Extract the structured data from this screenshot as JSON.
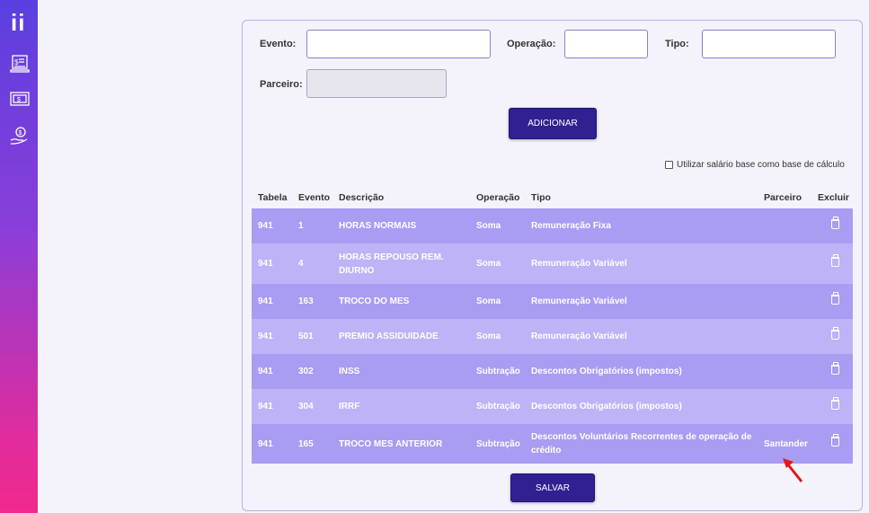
{
  "sidebar": {
    "logo": "ii",
    "items": [
      {
        "icon": "payroll-screen-icon"
      },
      {
        "icon": "banknote-icon"
      },
      {
        "icon": "hand-money-icon"
      }
    ]
  },
  "form": {
    "evento_label": "Evento:",
    "evento_value": "",
    "operacao_label": "Operação:",
    "operacao_value": "",
    "tipo_label": "Tipo:",
    "tipo_value": "",
    "parceiro_label": "Parceiro:",
    "parceiro_value": "",
    "add_button": "ADICIONAR",
    "checkbox_label": "Utilizar salário base como base de cálculo",
    "checkbox_checked": false
  },
  "table": {
    "headers": [
      "Tabela",
      "Evento",
      "Descrição",
      "Operação",
      "Tipo",
      "Parceiro",
      "Excluir"
    ],
    "rows": [
      {
        "tabela": "941",
        "evento": "1",
        "descricao": "HORAS NORMAIS",
        "operacao": "Soma",
        "tipo": "Remuneração Fixa",
        "parceiro": ""
      },
      {
        "tabela": "941",
        "evento": "4",
        "descricao": "HORAS REPOUSO REM. DIURNO",
        "operacao": "Soma",
        "tipo": "Remuneração Variável",
        "parceiro": ""
      },
      {
        "tabela": "941",
        "evento": "163",
        "descricao": "TROCO DO MES",
        "operacao": "Soma",
        "tipo": "Remuneração Variável",
        "parceiro": ""
      },
      {
        "tabela": "941",
        "evento": "501",
        "descricao": "PREMIO ASSIDUIDADE",
        "operacao": "Soma",
        "tipo": "Remuneração Variável",
        "parceiro": ""
      },
      {
        "tabela": "941",
        "evento": "302",
        "descricao": "INSS",
        "operacao": "Subtração",
        "tipo": "Descontos Obrigatórios (impostos)",
        "parceiro": ""
      },
      {
        "tabela": "941",
        "evento": "304",
        "descricao": "IRRF",
        "operacao": "Subtração",
        "tipo": "Descontos Obrigatórios (impostos)",
        "parceiro": ""
      },
      {
        "tabela": "941",
        "evento": "165",
        "descricao": "TROCO MES ANTERIOR",
        "operacao": "Subtração",
        "tipo": "Descontos Voluntários Recorrentes de operação de crédito",
        "parceiro": "Santander"
      }
    ]
  },
  "save_button": "SALVAR"
}
